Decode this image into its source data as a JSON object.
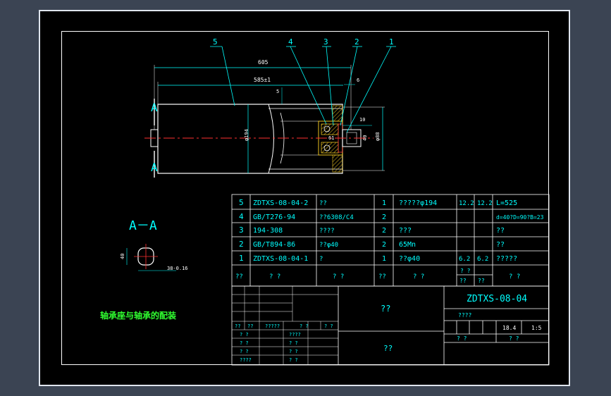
{
  "balloons": [
    "5",
    "4",
    "3",
    "2",
    "1"
  ],
  "dims": {
    "overall": "605",
    "length": "585±1",
    "gap5": "5",
    "gap6": "6",
    "gap10": "10",
    "bore": "61",
    "shaft": "40",
    "outer": "φ194",
    "right": "φ88"
  },
  "section": {
    "marker": "A",
    "title": "A－A",
    "dim40": "40",
    "dim38": "38-0.16"
  },
  "caption": "轴承座与轴承的配装",
  "bom": [
    {
      "no": "5",
      "code": "ZDTXS-08-04-2",
      "name": "??",
      "qty": "1",
      "mat": "?????φ194",
      "w1": "12.2",
      "w2": "12.2",
      "note": "L=525"
    },
    {
      "no": "4",
      "code": "GB/T276-94",
      "name": "??6308/C4",
      "qty": "2",
      "mat": "",
      "w1": "",
      "w2": "",
      "note": "d=40?D=90?B=23"
    },
    {
      "no": "3",
      "code": "194-308",
      "name": "????",
      "qty": "2",
      "mat": "???",
      "w1": "",
      "w2": "",
      "note": "??"
    },
    {
      "no": "2",
      "code": "GB/T894-86",
      "name": "??φ40",
      "qty": "2",
      "mat": "65Mn",
      "w1": "",
      "w2": "",
      "note": "??"
    },
    {
      "no": "1",
      "code": "ZDTXS-08-04-1",
      "name": "?",
      "qty": "1",
      "mat": "??φ40",
      "w1": "6.2",
      "w2": "6.2",
      "note": "?????"
    }
  ],
  "bom_header": {
    "no": "??",
    "code": "?  ?",
    "name": "?  ?",
    "qty": "??",
    "mat": "?  ?",
    "w_top": "? ?",
    "w_l": "??",
    "w_r": "??",
    "note": "?  ?"
  },
  "title_block": {
    "center_top": "??",
    "center_bottom": "??",
    "drawing_no": "ZDTXS-08-04",
    "label_a": "????",
    "weight": "18.4",
    "scale": "1:5",
    "sheet_a": "?  ?",
    "sheet_b": "?  ?",
    "left_row_a": [
      "??",
      "??",
      "?????",
      "?  ?",
      "? ?"
    ],
    "left_rows": [
      [
        "? ?",
        "????"
      ],
      [
        "? ?",
        "? ?"
      ],
      [
        "? ?",
        "? ?"
      ],
      [
        "????",
        "? ?"
      ]
    ]
  }
}
